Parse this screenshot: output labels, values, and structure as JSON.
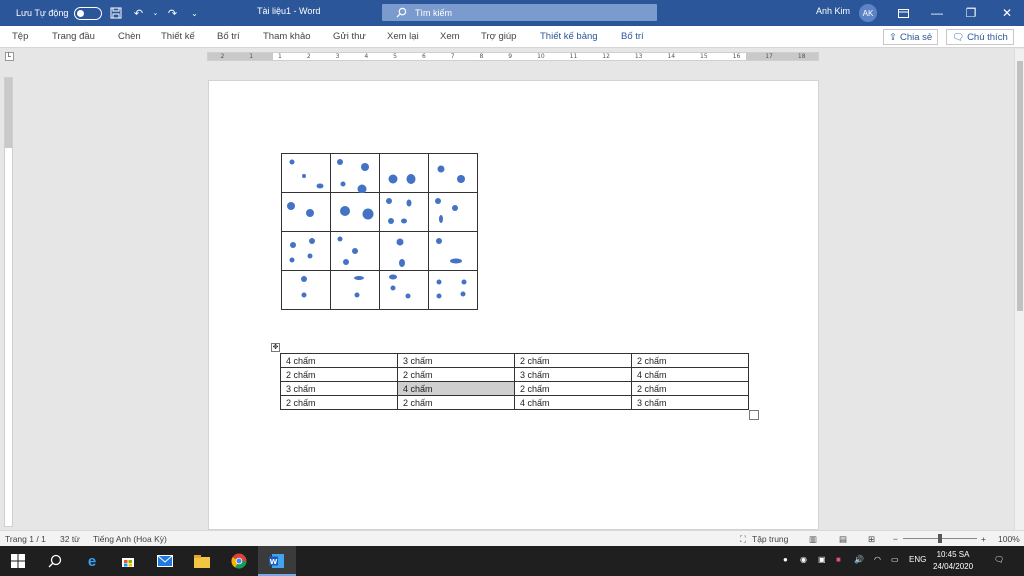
{
  "titlebar": {
    "autosave_label": "Lưu Tự động",
    "doc_title": "Tài liệu1  -  Word",
    "search_placeholder": "Tìm kiếm",
    "user_name": "Anh Kim",
    "user_initials": "AK",
    "bg_color": "#2b579a"
  },
  "ribbon": {
    "tabs": [
      "Tệp",
      "Trang đầu",
      "Chèn",
      "Thiết kế",
      "Bố trí",
      "Tham khảo",
      "Gửi thư",
      "Xem lại",
      "Xem",
      "Trợ giúp",
      "Thiết kế bảng",
      "Bố trí"
    ],
    "share_label": "Chia sẻ",
    "comments_label": "Chú thích"
  },
  "ruler": {
    "ticks": [
      "2",
      "1",
      "1",
      "2",
      "3",
      "4",
      "5",
      "6",
      "7",
      "8",
      "9",
      "10",
      "11",
      "12",
      "13",
      "14",
      "15",
      "16",
      "17",
      "18"
    ]
  },
  "document": {
    "count_table": [
      [
        "4 chấm",
        "3 chấm",
        "2 chấm",
        "2 chấm"
      ],
      [
        "2 chấm",
        "2 chấm",
        "3 chấm",
        "4 chấm"
      ],
      [
        "3 chấm",
        "4 chấm",
        "2 chấm",
        "2 chấm"
      ],
      [
        "2 chấm",
        "2 chấm",
        "4 chấm",
        "3 chấm"
      ]
    ],
    "dot_color": "#4472c4"
  },
  "statusbar": {
    "page": "Trang 1 / 1",
    "words": "32 từ",
    "language": "Tiếng Anh (Hoa Kỳ)",
    "focus": "Tập trung",
    "zoom": "100%"
  },
  "taskbar": {
    "lang": "ENG",
    "time": "10:45 SA",
    "date": "24/04/2020"
  }
}
